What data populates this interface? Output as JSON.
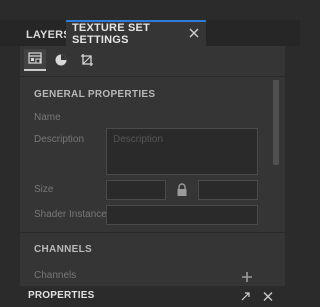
{
  "tabs": {
    "layers": "LAYERS",
    "texture_set_settings": "TEXTURE SET SETTINGS",
    "close_icon": "close-icon"
  },
  "toolbar": {
    "icons": [
      "texture-set-list-icon",
      "material-ball-icon",
      "uv-crop-icon"
    ]
  },
  "general": {
    "title": "GENERAL PROPERTIES",
    "name_label": "Name",
    "description_label": "Description",
    "description_placeholder": "Description",
    "size_label": "Size",
    "size_value_1": "",
    "size_value_2": "",
    "lock_icon": "lock-icon",
    "shader_instance_label": "Shader Instance",
    "shader_instance_value": ""
  },
  "channels": {
    "title": "CHANNELS",
    "channels_label": "Channels",
    "add_icon": "plus-icon"
  },
  "bottom_panel": {
    "title": "PROPERTIES",
    "icons": [
      "maximize-icon",
      "close-icon"
    ]
  },
  "colors": {
    "accent": "#2f7cd6",
    "panel_bg": "#353535",
    "app_bg": "#2b2b2b"
  }
}
